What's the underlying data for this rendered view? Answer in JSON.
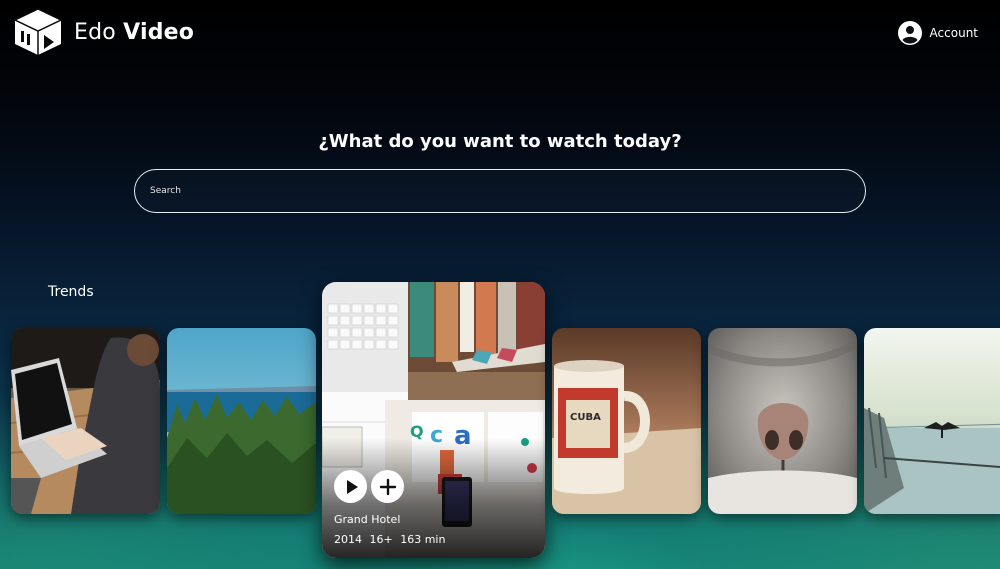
{
  "app": {
    "name_regular": "Edo",
    "name_bold": "Video",
    "logo_icon": "cube-play-icon"
  },
  "header": {
    "account_label": "Account",
    "account_icon": "user-circle-icon"
  },
  "hero": {
    "headline": "¿What do you want to watch today?",
    "search_placeholder": "Search"
  },
  "trends": {
    "title": "Trends",
    "featured": {
      "title": "Grand Hotel",
      "year": "2014",
      "rating": "16+",
      "duration": "163 min",
      "play_icon": "play-icon",
      "add_icon": "plus-icon"
    },
    "items": [
      {
        "thumbnail": "laptop-on-desk"
      },
      {
        "thumbnail": "forest-and-sea"
      },
      {
        "thumbnail": "desk-with-books-and-phone"
      },
      {
        "thumbnail": "coffee-mug"
      },
      {
        "thumbnail": "cat-nose"
      },
      {
        "thumbnail": "lake-with-bird"
      }
    ]
  },
  "colors": {
    "text": "#ffffff",
    "accent_teal": "#1aa08a",
    "background_top": "#000000"
  }
}
